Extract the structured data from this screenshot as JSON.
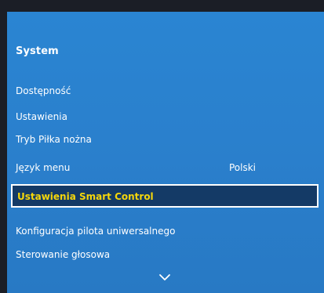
{
  "menu": {
    "title": "System",
    "items": [
      {
        "label": "Dostępność"
      },
      {
        "label": "Ustawienia"
      },
      {
        "label": "Tryb Piłka nożna"
      },
      {
        "label": "Język menu",
        "value": "Polski"
      },
      {
        "label": "Ustawienia Smart Control",
        "selected": true
      },
      {
        "label": "Konfiguracja pilota uniwersalnego"
      },
      {
        "label": "Sterowanie głosowa"
      }
    ]
  },
  "icons": {
    "scroll_down": "chevron-down-icon"
  },
  "colors": {
    "panel_blue": "#2a80cd",
    "selected_bg": "#143a66",
    "selected_text": "#f5d60a",
    "border": "#ffffff",
    "background": "#1b1e26"
  }
}
